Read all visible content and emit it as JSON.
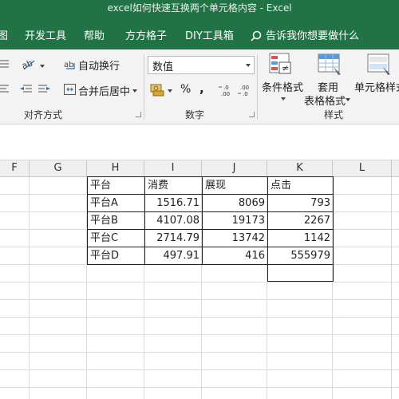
{
  "window": {
    "title": "excel如何快速互换两个单元格内容  -  Excel"
  },
  "ribbon_tabs": [
    "图",
    "开发工具",
    "帮助",
    "方方格子",
    "DIY工具箱"
  ],
  "tell_me": "告诉我你想要做什么",
  "alignment": {
    "wrap_text": "自动换行",
    "merge_center": "合并后居中",
    "group_label": "对齐方式"
  },
  "number": {
    "format_value": "数值",
    "percent": "%",
    "comma": ",",
    "group_label": "数字"
  },
  "styles": {
    "conditional_formatting": "条件格式",
    "format_as_table_line1": "套用",
    "format_as_table_line2": "表格格式",
    "cell_styles": "单元格样式",
    "group_label": "样式"
  },
  "columns": [
    "F",
    "G",
    "H",
    "I",
    "J",
    "K",
    "L"
  ],
  "table": {
    "headers": [
      "平台",
      "消费",
      "展现",
      "点击"
    ],
    "rows": [
      [
        "平台A",
        "1516.71",
        "8069",
        "793"
      ],
      [
        "平台B",
        "4107.08",
        "19173",
        "2267"
      ],
      [
        "平台C",
        "2714.79",
        "13742",
        "1142"
      ],
      [
        "平台D",
        "497.91",
        "416",
        "555979"
      ]
    ]
  },
  "colors": {
    "ribbon_green": "#217346",
    "ribbon_bg": "#f3f3f3",
    "grid_line": "#dadada"
  }
}
